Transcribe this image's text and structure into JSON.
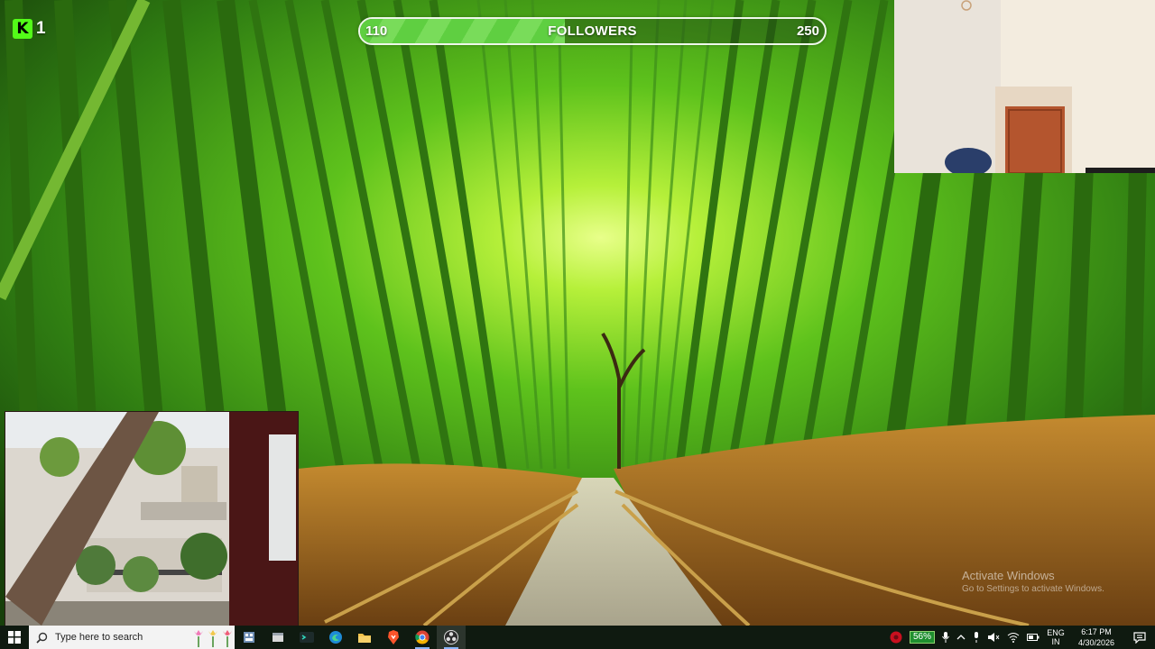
{
  "overlay": {
    "kick": {
      "logo_letter": "K",
      "count": "1",
      "brand_color": "#53fc18"
    },
    "follower_goal": {
      "current": "110",
      "label": "FOLLOWERS",
      "target": "250",
      "progress_fraction": 0.44,
      "fill_color": "#5fcf41"
    },
    "webcams": [
      "room-camera",
      "window-camera"
    ]
  },
  "watermark": {
    "title": "Activate Windows",
    "subtitle": "Go to Settings to activate Windows."
  },
  "taskbar": {
    "search_placeholder": "Type here to search",
    "pinned": [
      {
        "name": "task-view-icon"
      },
      {
        "name": "file-explorer-icon"
      },
      {
        "name": "terminal-icon"
      },
      {
        "name": "edge-icon"
      },
      {
        "name": "folder-icon"
      },
      {
        "name": "brave-icon"
      },
      {
        "name": "chrome-icon"
      },
      {
        "name": "obs-icon"
      }
    ],
    "tray": {
      "battery": "56%",
      "language_line1": "ENG",
      "language_line2": "IN",
      "time": "6:17 PM",
      "date": "4/30/2026"
    }
  }
}
